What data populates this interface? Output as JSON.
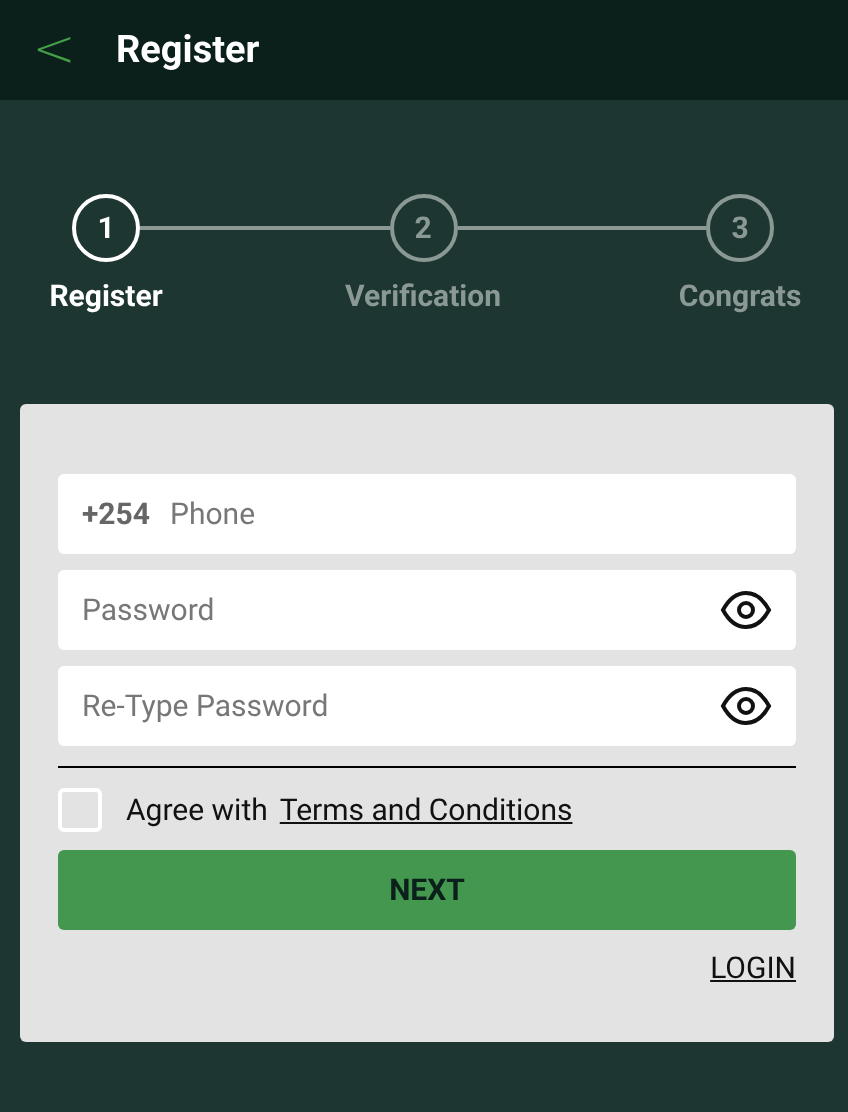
{
  "header": {
    "back": "<",
    "title": "Register"
  },
  "steps": [
    {
      "number": "1",
      "label": "Register",
      "selected": true
    },
    {
      "number": "2",
      "label": "Verification",
      "selected": false
    },
    {
      "number": "3",
      "label": "Congrats",
      "selected": false
    }
  ],
  "fields": [
    {
      "kind": "phone",
      "prefix": "+254",
      "placeholder": "Phone"
    },
    {
      "kind": "password",
      "placeholder": "Password"
    },
    {
      "kind": "password",
      "placeholder": "Re-Type Password"
    }
  ],
  "agree": {
    "checked": false,
    "text": "Agree with",
    "link": "Terms and Conditions"
  },
  "next_button": "NEXT",
  "login_link": "LOGIN"
}
